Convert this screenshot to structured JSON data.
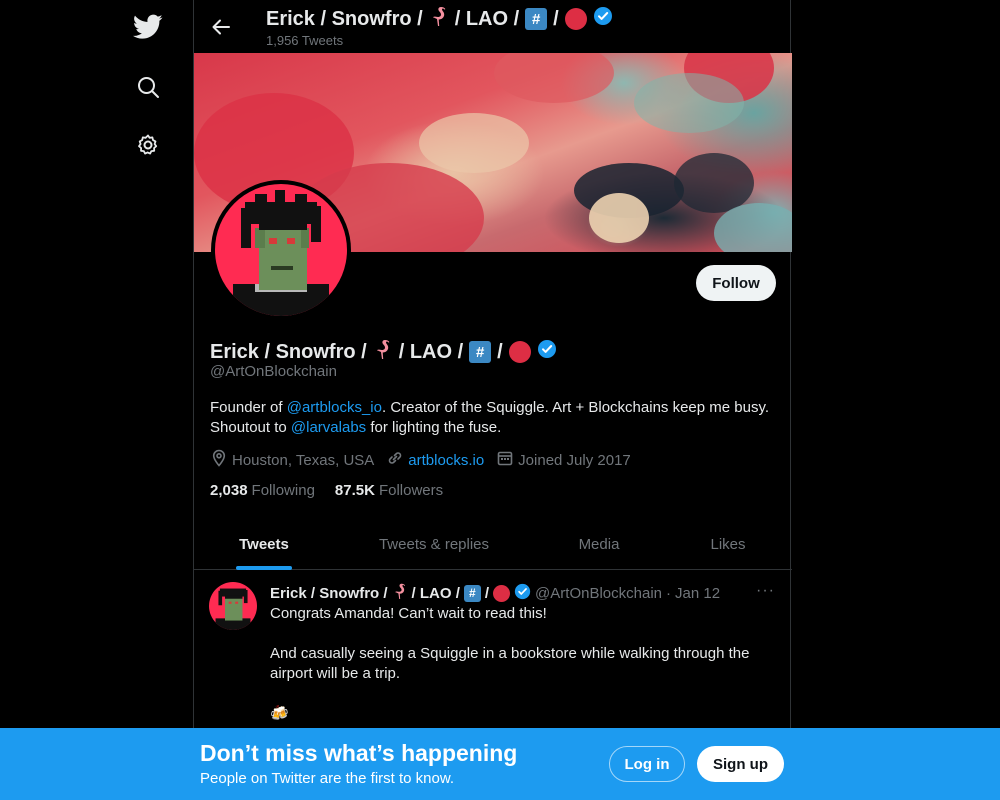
{
  "nav": {
    "items": [
      {
        "name": "twitter-logo-icon"
      },
      {
        "name": "search-icon"
      },
      {
        "name": "settings-gear-icon"
      }
    ]
  },
  "header": {
    "title_pre": "Erick / Snowfro /",
    "title_mid": "/ LAO /",
    "title_sep": "/",
    "hash_glyph": "#",
    "tweet_count": "1,956 Tweets"
  },
  "profile": {
    "name_pre": "Erick / Snowfro /",
    "name_mid": "/ LAO /",
    "name_sep": "/",
    "hash_glyph": "#",
    "handle": "@ArtOnBlockchain",
    "follow_label": "Follow",
    "bio": {
      "part1": "Founder of ",
      "link1": "@artblocks_io",
      "part2": ". Creator of the Squiggle. Art + Blockchains keep me busy. Shoutout to ",
      "link2": "@larvalabs",
      "part3": " for lighting the fuse."
    },
    "location": "Houston, Texas, USA",
    "website": "artblocks.io",
    "joined": "Joined July 2017",
    "following_count": "2,038",
    "following_label": "Following",
    "followers_count": "87.5K",
    "followers_label": "Followers"
  },
  "tabs": [
    {
      "label": "Tweets",
      "active": true
    },
    {
      "label": "Tweets & replies",
      "active": false
    },
    {
      "label": "Media",
      "active": false
    },
    {
      "label": "Likes",
      "active": false
    }
  ],
  "tweet": {
    "name_pre": "Erick / Snowfro /",
    "name_mid": "/ LAO /",
    "name_sep": "/",
    "hash_glyph": "#",
    "handle": "@ArtOnBlockchain",
    "dot": "·",
    "date": "Jan 12",
    "more": "···",
    "line1": "Congrats Amanda! Can’t wait to read this!",
    "line2": "And casually seeing a Squiggle in a bookstore while walking through the airport will be a trip.",
    "emoji": "🍻"
  },
  "bottom_bar": {
    "title": "Don’t miss what’s happening",
    "subtitle": "People on Twitter are the first to know.",
    "login_label": "Log in",
    "signup_label": "Sign up"
  },
  "colors": {
    "background": "#000000",
    "accent": "#1d9bf0",
    "muted_text": "#71767b",
    "verified": "#1d9bf0",
    "hash_box": "#3b88c3",
    "red_circle": "#dd2e44"
  }
}
